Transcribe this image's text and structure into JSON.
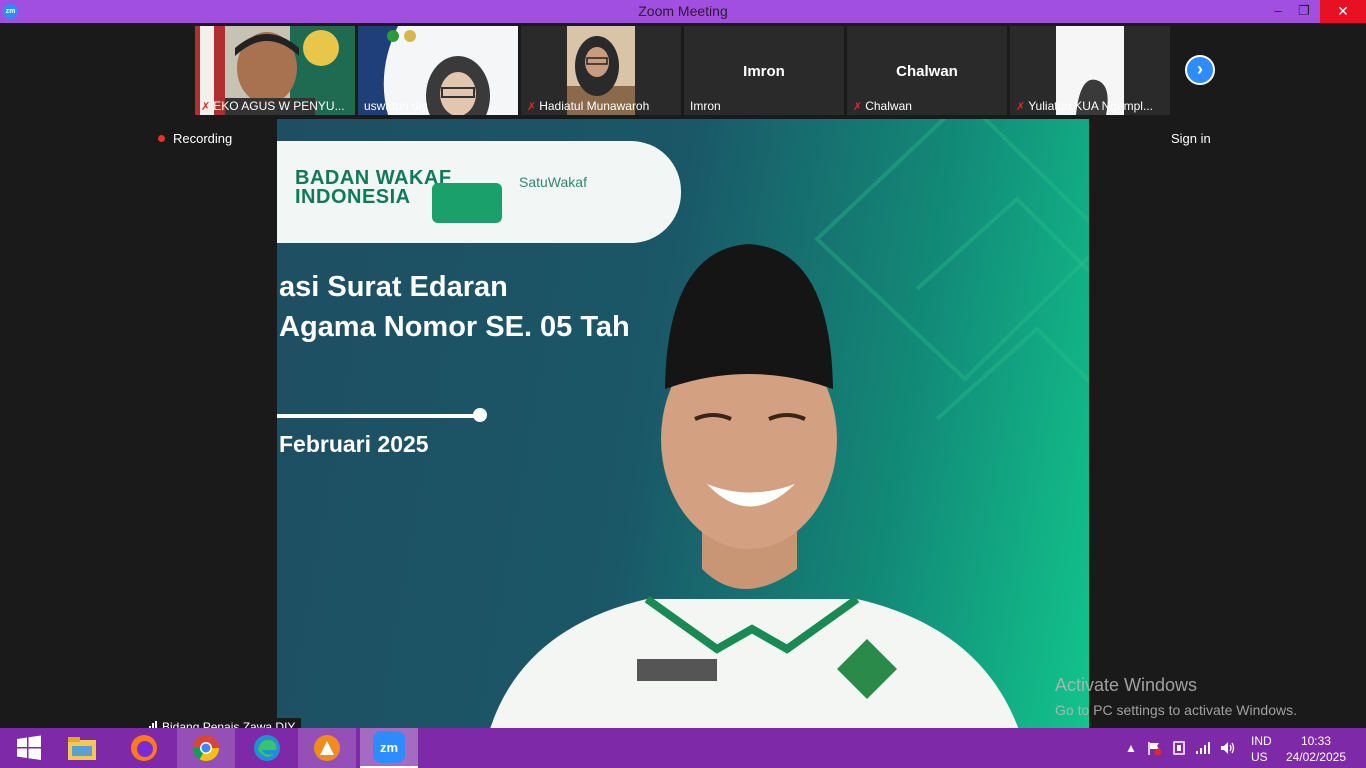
{
  "window": {
    "title": "Zoom Meeting",
    "app_icon": "zm"
  },
  "participants": [
    {
      "name": "EKO AGUS W PENYU...",
      "muted": true,
      "has_video": true
    },
    {
      "name": "uswatun diy",
      "muted": false,
      "has_video": true
    },
    {
      "name": "Hadiatul Munawaroh",
      "muted": true,
      "has_video": true
    },
    {
      "name": "Imron",
      "muted": false,
      "has_video": false,
      "display_label": "Imron"
    },
    {
      "name": "Chalwan",
      "muted": true,
      "has_video": false,
      "display_label": "Chalwan"
    },
    {
      "name": "Yuliatun KUA Ngempl...",
      "muted": true,
      "has_video": true
    }
  ],
  "recording": {
    "label": "Recording"
  },
  "signin": {
    "label": "Sign in"
  },
  "main_video": {
    "speaker_name": "Bidang Penais Zawa DIY",
    "banner": {
      "brand1_line1": "BADAN WAKAF",
      "brand1_line2": "INDONESIA",
      "brand3": "SatuWakaf"
    },
    "slide_line1": "asi Surat Edaran",
    "slide_line2": "Agama Nomor SE. 05 Tah",
    "slide_date": "Februari 2025"
  },
  "watermark": {
    "line1": "Activate Windows",
    "line2": "Go to PC settings to activate Windows."
  },
  "taskbar": {
    "lang1": "IND",
    "lang2": "US",
    "time": "10:33",
    "date": "24/02/2025"
  },
  "colors": {
    "titlebar": "#a04fe0",
    "taskbar": "#7e2aa8",
    "zoom_blue": "#2d8cff",
    "recording_red": "#e8302c"
  }
}
